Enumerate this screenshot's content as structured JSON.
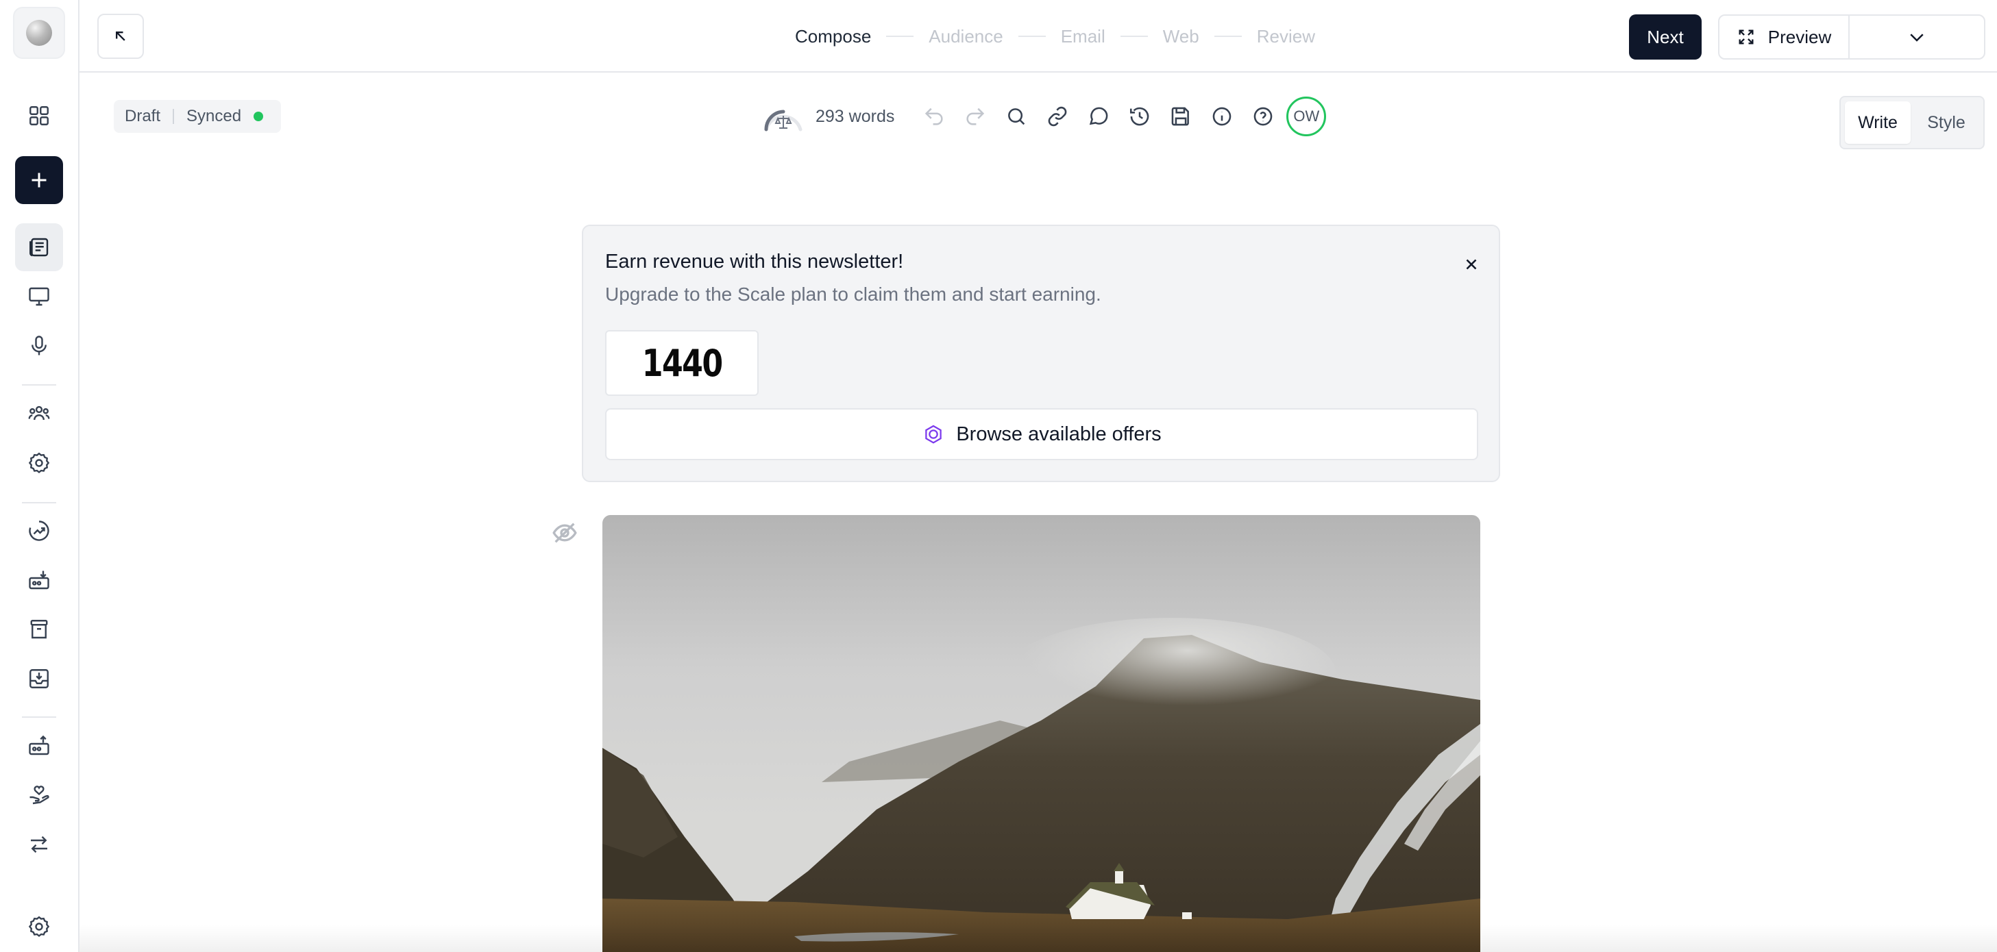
{
  "steps": [
    {
      "label": "Compose",
      "current": true
    },
    {
      "label": "Audience",
      "current": false
    },
    {
      "label": "Email",
      "current": false
    },
    {
      "label": "Web",
      "current": false
    },
    {
      "label": "Review",
      "current": false
    }
  ],
  "header": {
    "next_label": "Next",
    "preview_label": "Preview"
  },
  "status": {
    "draft_label": "Draft",
    "sync_label": "Synced",
    "sync_color": "#22c55e"
  },
  "toolbar": {
    "word_count": "293 words",
    "avatar_initials": "OW"
  },
  "mode": {
    "write_label": "Write",
    "style_label": "Style",
    "active": "Write"
  },
  "offer": {
    "title": "Earn revenue with this newsletter!",
    "subtitle": "Upgrade to the Scale plan to claim them and start earning.",
    "partner_logo_text": "1440",
    "browse_label": "Browse available offers",
    "browse_icon_color": "#7c3aed"
  },
  "icons": {
    "sidebar": [
      "dashboard-icon",
      "plus-icon",
      "posts-icon",
      "monitor-icon",
      "microphone-icon",
      "audience-icon",
      "settings-icon",
      "growth-icon",
      "download-box-icon",
      "store-icon",
      "inbox-icon",
      "upload-box-icon",
      "hand-heart-icon",
      "swap-icon",
      "settings-icon"
    ],
    "toolbar": [
      "undo-icon",
      "redo-icon",
      "search-icon",
      "link-icon",
      "comment-icon",
      "history-icon",
      "save-icon",
      "info-icon",
      "help-icon"
    ]
  },
  "colors": {
    "primary": "#0f172a",
    "accent_green": "#22c55e"
  }
}
